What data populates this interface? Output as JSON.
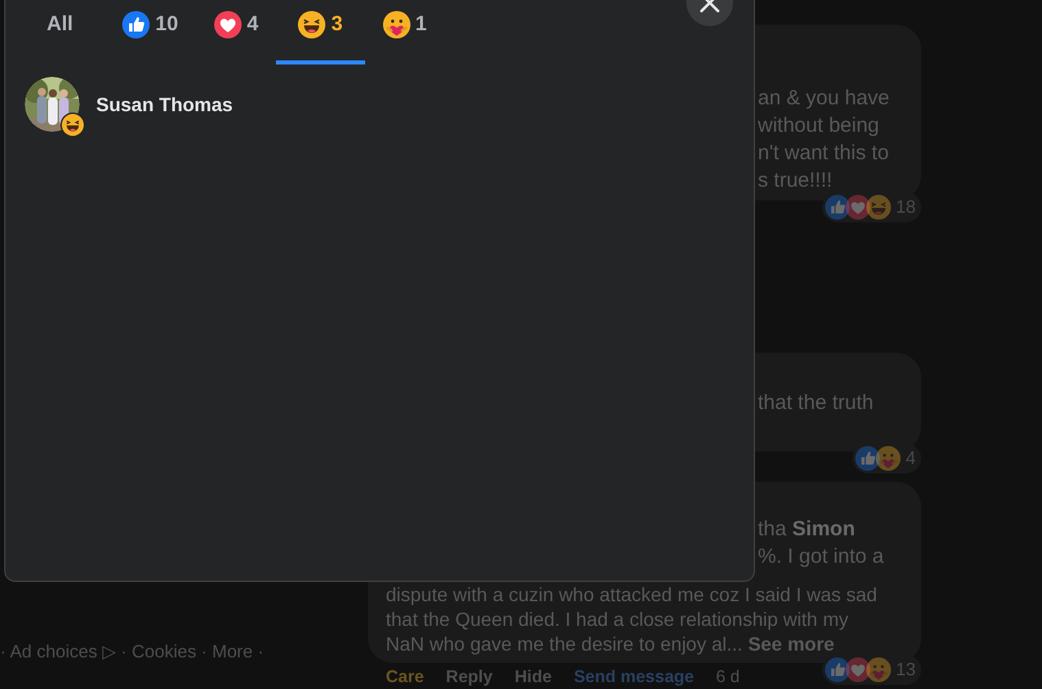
{
  "reaction_tabs": [
    {
      "kind": "all",
      "label": "All",
      "selected": false
    },
    {
      "kind": "like",
      "count": "10",
      "selected": false
    },
    {
      "kind": "love",
      "count": "4",
      "selected": false
    },
    {
      "kind": "haha",
      "count": "3",
      "selected": true
    },
    {
      "kind": "care",
      "count": "1",
      "selected": false
    }
  ],
  "people": [
    {
      "name": "Susan Thomas",
      "badge": {
        "kind": "haha"
      }
    }
  ],
  "background": {
    "comments": [
      {
        "lines": [
          "an & you have",
          "without being",
          "n't want this to",
          "s true!!!!"
        ],
        "reactions": [
          {
            "kind": "like"
          },
          {
            "kind": "love"
          },
          {
            "kind": "haha"
          }
        ],
        "count": "18"
      },
      {
        "lines": [
          "that the truth"
        ],
        "reactions": [
          {
            "kind": "like"
          },
          {
            "kind": "care"
          }
        ],
        "count": "4"
      },
      {
        "lines": [
          "tha **Simon**",
          "%. I got into a"
        ],
        "full_lines": [
          "dispute with a cuzin who attacked me coz I said I was sad",
          "that the Queen died. I had a close relationship with my",
          "NaN who gave me the desire to enjoy al... **See more**"
        ],
        "reactions": [
          {
            "kind": "like"
          },
          {
            "kind": "love"
          },
          {
            "kind": "care"
          }
        ],
        "count": "13"
      }
    ],
    "comment_actions": [
      {
        "kind": "reaction",
        "label": "Care"
      },
      {
        "kind": "plain",
        "label": "Reply"
      },
      {
        "kind": "plain",
        "label": "Hide"
      },
      {
        "kind": "link",
        "label": "Send message"
      },
      {
        "kind": "time",
        "label": "6 d"
      }
    ],
    "footer_links": "· Ad choices ▷ · Cookies · More ·"
  }
}
